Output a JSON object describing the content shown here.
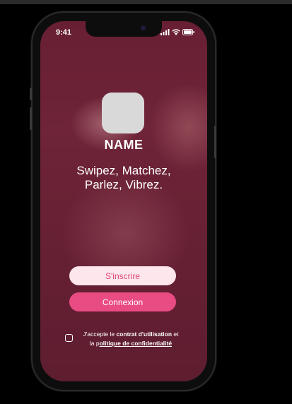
{
  "status_bar": {
    "time": "9:41"
  },
  "app": {
    "name": "NAME",
    "tagline_line1": "Swipez, Matchez,",
    "tagline_line2": "Parlez, Vibrez."
  },
  "buttons": {
    "register_label": "S'inscrire",
    "login_label": "Connexion"
  },
  "terms": {
    "prefix": "J'accepte le ",
    "contract_link": "contrat  d'utilisation",
    "middle": " et",
    "line2_prefix": "la p",
    "privacy_link": "olitique de confidentialité"
  },
  "colors": {
    "accent": "#e94b83",
    "register_bg": "#fde7ec",
    "register_text": "#e0457b",
    "overlay": "#6b2236"
  },
  "icons": [
    "signal-icon",
    "wifi-icon",
    "battery-icon"
  ]
}
